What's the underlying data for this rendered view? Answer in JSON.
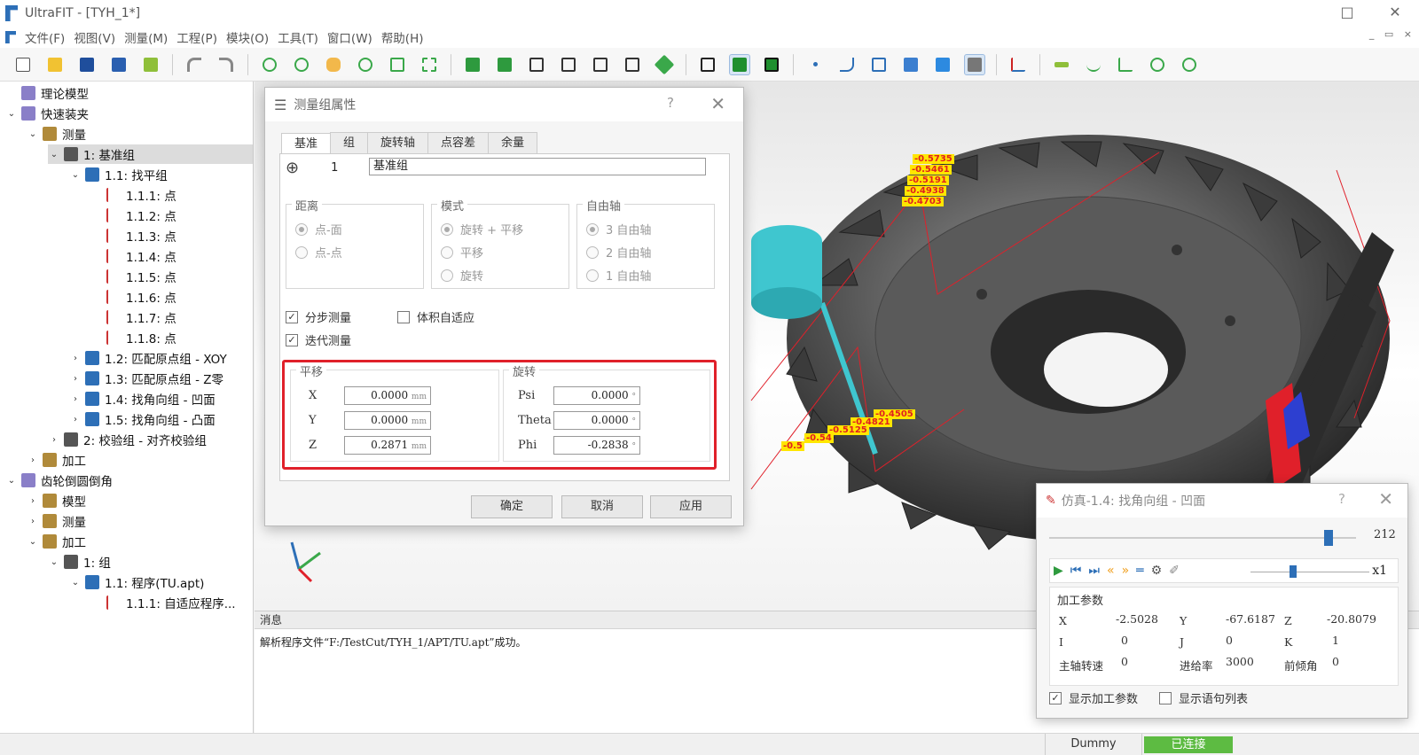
{
  "window": {
    "title": "UltraFIT - [TYH_1*]",
    "controls": [
      "□",
      "✕"
    ]
  },
  "menu": [
    "文件(F)",
    "视图(V)",
    "测量(M)",
    "工程(P)",
    "模块(O)",
    "工具(T)",
    "窗口(W)",
    "帮助(H)"
  ],
  "mdi_controls": "_ ▭ ×",
  "tree": [
    {
      "label": "理论模型",
      "indent": 0,
      "arrow": ""
    },
    {
      "label": "快速装夹",
      "indent": 0,
      "arrow": "⌄"
    },
    {
      "label": "测量",
      "indent": 1,
      "arrow": "⌄"
    },
    {
      "label": "1: 基准组",
      "indent": 2,
      "arrow": "⌄",
      "selected": true
    },
    {
      "label": "1.1: 找平组",
      "indent": 3,
      "arrow": "⌄"
    },
    {
      "label": "1.1.1: 点",
      "indent": 4,
      "arrow": ""
    },
    {
      "label": "1.1.2: 点",
      "indent": 4,
      "arrow": ""
    },
    {
      "label": "1.1.3: 点",
      "indent": 4,
      "arrow": ""
    },
    {
      "label": "1.1.4: 点",
      "indent": 4,
      "arrow": ""
    },
    {
      "label": "1.1.5: 点",
      "indent": 4,
      "arrow": ""
    },
    {
      "label": "1.1.6: 点",
      "indent": 4,
      "arrow": ""
    },
    {
      "label": "1.1.7: 点",
      "indent": 4,
      "arrow": ""
    },
    {
      "label": "1.1.8: 点",
      "indent": 4,
      "arrow": ""
    },
    {
      "label": "1.2: 匹配原点组 - XOY",
      "indent": 3,
      "arrow": "›"
    },
    {
      "label": "1.3: 匹配原点组 - Z零",
      "indent": 3,
      "arrow": "›"
    },
    {
      "label": "1.4: 找角向组 - 凹面",
      "indent": 3,
      "arrow": "›"
    },
    {
      "label": "1.5: 找角向组 - 凸面",
      "indent": 3,
      "arrow": "›"
    },
    {
      "label": "2: 校验组 - 对齐校验组",
      "indent": 2,
      "arrow": "›"
    },
    {
      "label": "加工",
      "indent": 1,
      "arrow": "›"
    },
    {
      "label": "齿轮倒圆倒角",
      "indent": 0,
      "arrow": "⌄"
    },
    {
      "label": "模型",
      "indent": 1,
      "arrow": "›"
    },
    {
      "label": "测量",
      "indent": 1,
      "arrow": "›"
    },
    {
      "label": "加工",
      "indent": 1,
      "arrow": "⌄"
    },
    {
      "label": "1: 组",
      "indent": 2,
      "arrow": "⌄"
    },
    {
      "label": "1.1: 程序(TU.apt)",
      "indent": 3,
      "arrow": "⌄"
    },
    {
      "label": "1.1.1: 自适应程序...",
      "indent": 4,
      "arrow": ""
    }
  ],
  "dialog": {
    "title": "测量组属性",
    "help": "?",
    "close": "✕",
    "tabs": [
      "基准",
      "组",
      "旋转轴",
      "点容差",
      "余量"
    ],
    "index": "1",
    "name": "基准组",
    "distance": {
      "title": "距离",
      "options": [
        "点-面",
        "点-点"
      ]
    },
    "mode": {
      "title": "模式",
      "options": [
        "旋转 + 平移",
        "平移",
        "旋转"
      ]
    },
    "freeaxis": {
      "title": "自由轴",
      "options": [
        "3 自由轴",
        "2 自由轴",
        "1 自由轴"
      ]
    },
    "checks": {
      "step": "分步测量",
      "volume": "体积自适应",
      "iterate": "迭代测量"
    },
    "translate": {
      "title": "平移",
      "unit": "mm",
      "x_label": "X",
      "x": "0.0000",
      "y_label": "Y",
      "y": "0.0000",
      "z_label": "Z",
      "z": "0.2871"
    },
    "rotate": {
      "title": "旋转",
      "unit": "°",
      "psi_label": "Psi",
      "psi": "0.0000",
      "theta_label": "Theta",
      "theta": "0.0000",
      "phi_label": "Phi",
      "phi": "-0.2838"
    },
    "buttons": {
      "ok": "确定",
      "cancel": "取消",
      "apply": "应用"
    }
  },
  "labels_top": [
    "-0.5735",
    "-0.5461",
    "-0.5191",
    "-0.4938",
    "-0.4703"
  ],
  "labels_bottom": [
    "-0.4505",
    "-0.4821",
    "-0.5125",
    "-0.54",
    "-0.5"
  ],
  "messages": {
    "header": "消息",
    "line1": "解析程序文件“F:/TestCut/TYH_1/APT/TU.apt”成功。"
  },
  "sim": {
    "title": "仿真-1.4: 找角向组 - 凹面",
    "help": "?",
    "close": "✕",
    "frame": "212",
    "speed": "x1",
    "params_title": "加工参数",
    "X_label": "X",
    "X": "-2.5028",
    "Y_label": "Y",
    "Y": "-67.6187",
    "Z_label": "Z",
    "Z": "-20.8079",
    "I_label": "I",
    "I": "0",
    "J_label": "J",
    "J": "0",
    "K_label": "K",
    "K": "1",
    "spindle_label": "主轴转速",
    "spindle": "0",
    "feed_label": "进给率",
    "feed": "3000",
    "tilt_label": "前倾角",
    "tilt": "0",
    "show_params": "显示加工参数",
    "show_list": "显示语句列表"
  },
  "status": {
    "dummy": "Dummy",
    "connected": "已连接"
  },
  "colors": {
    "accent": "#2d6fb7",
    "highlight_red": "#e0202a",
    "connected_green": "#5dbb42",
    "label_yellow": "#ffe600",
    "probe_cyan": "#3fc6cf"
  }
}
